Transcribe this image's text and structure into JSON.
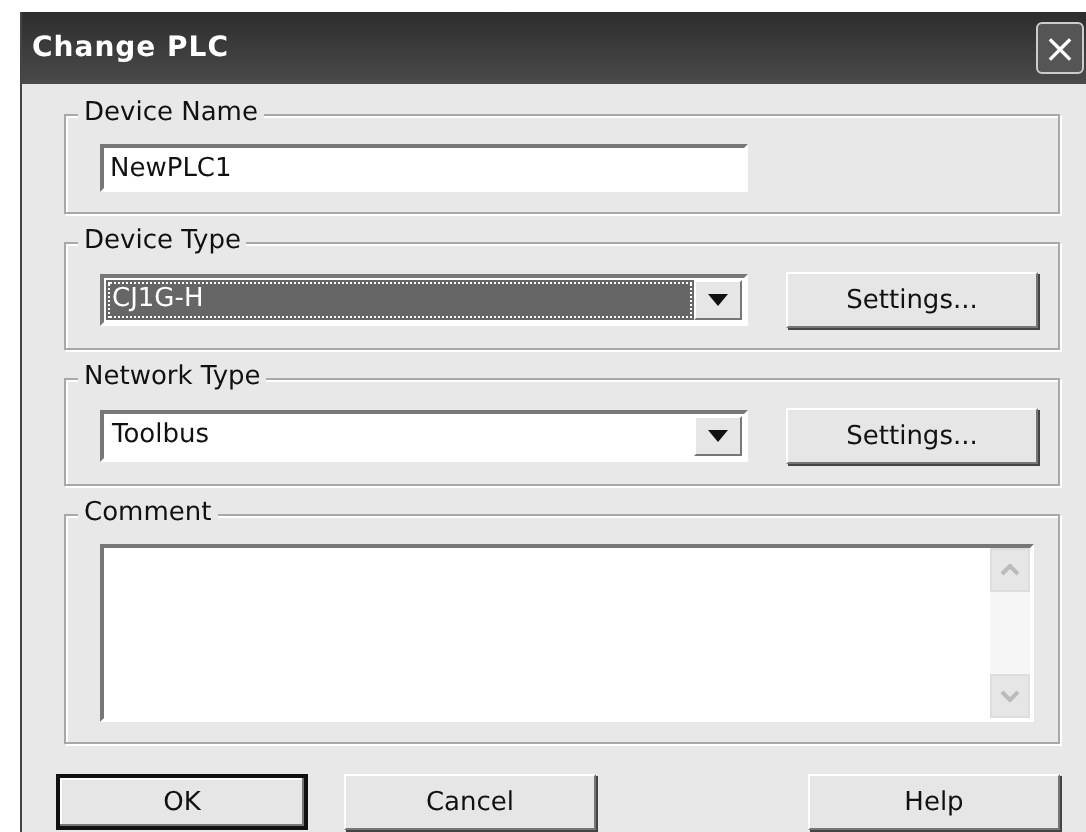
{
  "window": {
    "title": "Change PLC",
    "close_icon": "×"
  },
  "device_name": {
    "label": "Device Name",
    "value": "NewPLC1"
  },
  "device_type": {
    "label": "Device Type",
    "value": "CJ1G-H",
    "highlighted": true,
    "button": "Settings..."
  },
  "network_type": {
    "label": "Network Type",
    "value": "Toolbus",
    "highlighted": false,
    "button": "Settings..."
  },
  "comment": {
    "label": "Comment"
  },
  "buttons": [
    {
      "label": "OK",
      "default": true
    },
    {
      "label": "Cancel",
      "default": false
    },
    {
      "label": "Help",
      "default": false
    }
  ]
}
